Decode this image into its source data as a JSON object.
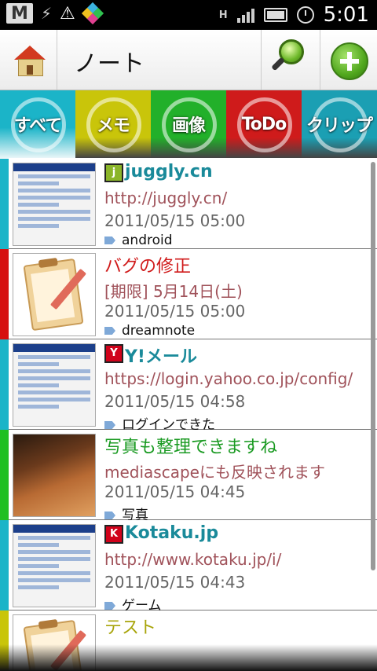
{
  "status_bar": {
    "time": "5:01",
    "network_indicator": "H",
    "icons": [
      "gmail-icon",
      "usb-icon",
      "warning-icon",
      "app-icon",
      "signal-icon",
      "battery-icon",
      "alarm-icon"
    ]
  },
  "app_bar": {
    "title": "ノート",
    "home_icon": "house-icon",
    "search_icon": "search-icon",
    "add_icon": "add-icon"
  },
  "tabs": [
    {
      "label": "すべて",
      "color": "#1bb4c8",
      "active": true
    },
    {
      "label": "メモ",
      "color": "#c9c50a",
      "active": false
    },
    {
      "label": "画像",
      "color": "#22b02a",
      "active": false
    },
    {
      "label": "ToDo",
      "color": "#cf1b1b",
      "active": false
    },
    {
      "label": "クリップ",
      "color": "#1b9fb3",
      "active": false
    }
  ],
  "notes": [
    {
      "kind": "clip",
      "accent": "#1bb4c8",
      "source_icon": "j",
      "source_color": "#8bb52a",
      "title": "juggly.cn",
      "line2": "http://juggly.cn/",
      "date": "2011/05/15 05:00",
      "tag": "android"
    },
    {
      "kind": "todo",
      "accent": "#d60f0f",
      "title": "バグの修正",
      "title_color": "#d01a1a",
      "line2": "[期限] 5月14日(土)",
      "date": "2011/05/15 05:00",
      "tag": "dreamnote"
    },
    {
      "kind": "clip",
      "accent": "#1bb4c8",
      "source_icon": "Y",
      "source_color": "#d0021b",
      "title": "Y!メール",
      "line2": "https://login.yahoo.co.jp/config/",
      "date": "2011/05/15 04:58",
      "tag": "ログインできた"
    },
    {
      "kind": "image",
      "accent": "#1fbf22",
      "title": "写真も整理できますね",
      "title_color": "#1a9a22",
      "line2": "mediascapeにも反映されます",
      "date": "2011/05/15 04:45",
      "tag": "写真"
    },
    {
      "kind": "clip",
      "accent": "#1bb4c8",
      "source_icon": "K",
      "source_color": "#d0021b",
      "title": "Kotaku.jp",
      "line2": "http://www.kotaku.jp/i/",
      "date": "2011/05/15 04:43",
      "tag": "ゲーム"
    },
    {
      "kind": "memo",
      "accent": "#c9c50a",
      "title": "テスト",
      "title_color": "#a8a40a"
    }
  ]
}
